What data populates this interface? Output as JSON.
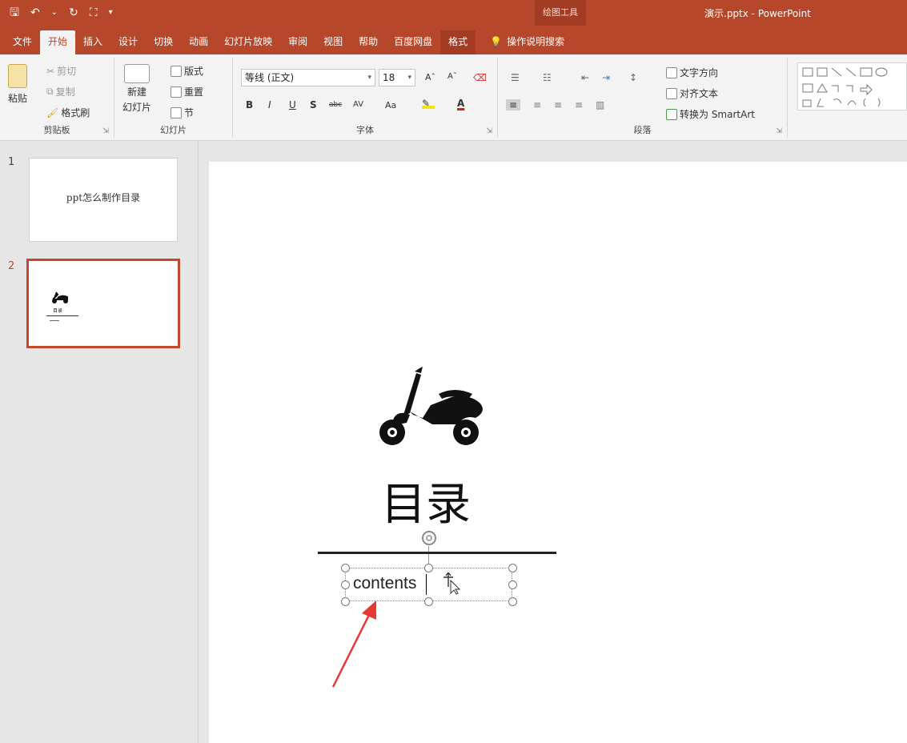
{
  "window": {
    "title": "演示.pptx  -  PowerPoint",
    "context_tools": "绘图工具"
  },
  "qat": {
    "save": "🖫",
    "undo": "↶",
    "undo_menu": "⌄",
    "redo": "↻",
    "present": "⛶",
    "customize": "▾"
  },
  "tabs": [
    "文件",
    "开始",
    "插入",
    "设计",
    "切换",
    "动画",
    "幻灯片放映",
    "审阅",
    "视图",
    "帮助",
    "百度网盘",
    "格式"
  ],
  "tell_me": {
    "icon": "💡",
    "label": "操作说明搜索"
  },
  "ribbon": {
    "clipboard": {
      "label": "剪贴板",
      "paste": "粘贴",
      "cut": "剪切",
      "copy": "复制",
      "format_painter": "格式刷"
    },
    "slides": {
      "label": "幻灯片",
      "new_slide_line1": "新建",
      "new_slide_line2": "幻灯片",
      "layout": "版式",
      "reset": "重置",
      "section": "节"
    },
    "font": {
      "label": "字体",
      "font_name": "等线 (正文)",
      "font_size": "18",
      "bold": "B",
      "italic": "I",
      "underline": "U",
      "shadow": "S",
      "strike": "abc",
      "spacing": "AV",
      "change_case": "Aa",
      "grow": "Aˆ",
      "shrink": "Aˇ"
    },
    "paragraph": {
      "label": "段落",
      "text_direction": "文字方向",
      "align_text": "对齐文本",
      "smartart": "转换为 SmartArt"
    }
  },
  "thumbnails": [
    {
      "number": "1",
      "title": "ppt怎么制作目录"
    },
    {
      "number": "2",
      "title": "目录"
    }
  ],
  "slide": {
    "title": "目录",
    "textbox_text": "contents"
  },
  "colors": {
    "brand": "#b7472a",
    "selection": "#c2492d",
    "annotation_arrow": "#e53935"
  }
}
